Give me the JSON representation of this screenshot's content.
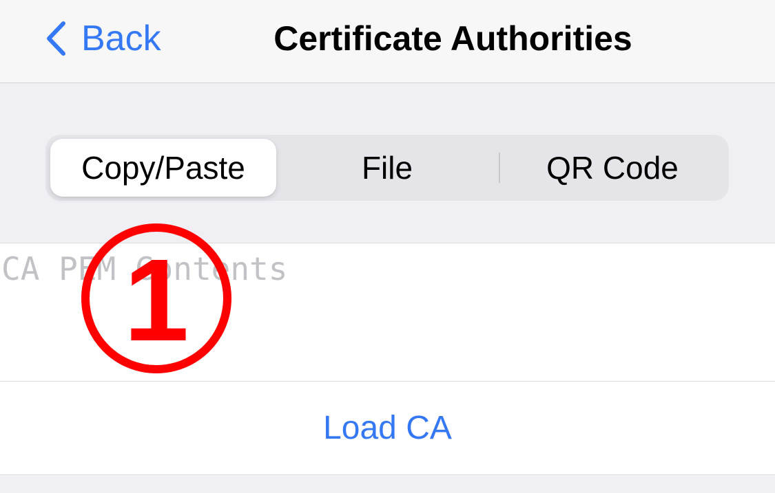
{
  "navbar": {
    "back_label": "Back",
    "back_icon": "chevron-left-icon",
    "title": "Certificate Authorities"
  },
  "segmented_control": {
    "selected": "Copy/Paste",
    "segments": [
      {
        "label": "Copy/Paste"
      },
      {
        "label": "File"
      },
      {
        "label": "QR Code"
      }
    ]
  },
  "pem_field": {
    "placeholder": "CA PEM Contents",
    "value": ""
  },
  "load_button": {
    "label": "Load CA"
  },
  "annotation": {
    "step_number": "1",
    "color": "#ff0000"
  },
  "colors": {
    "accent": "#3478f6",
    "background": "#efeff4",
    "navbar": "#f7f7f7"
  }
}
